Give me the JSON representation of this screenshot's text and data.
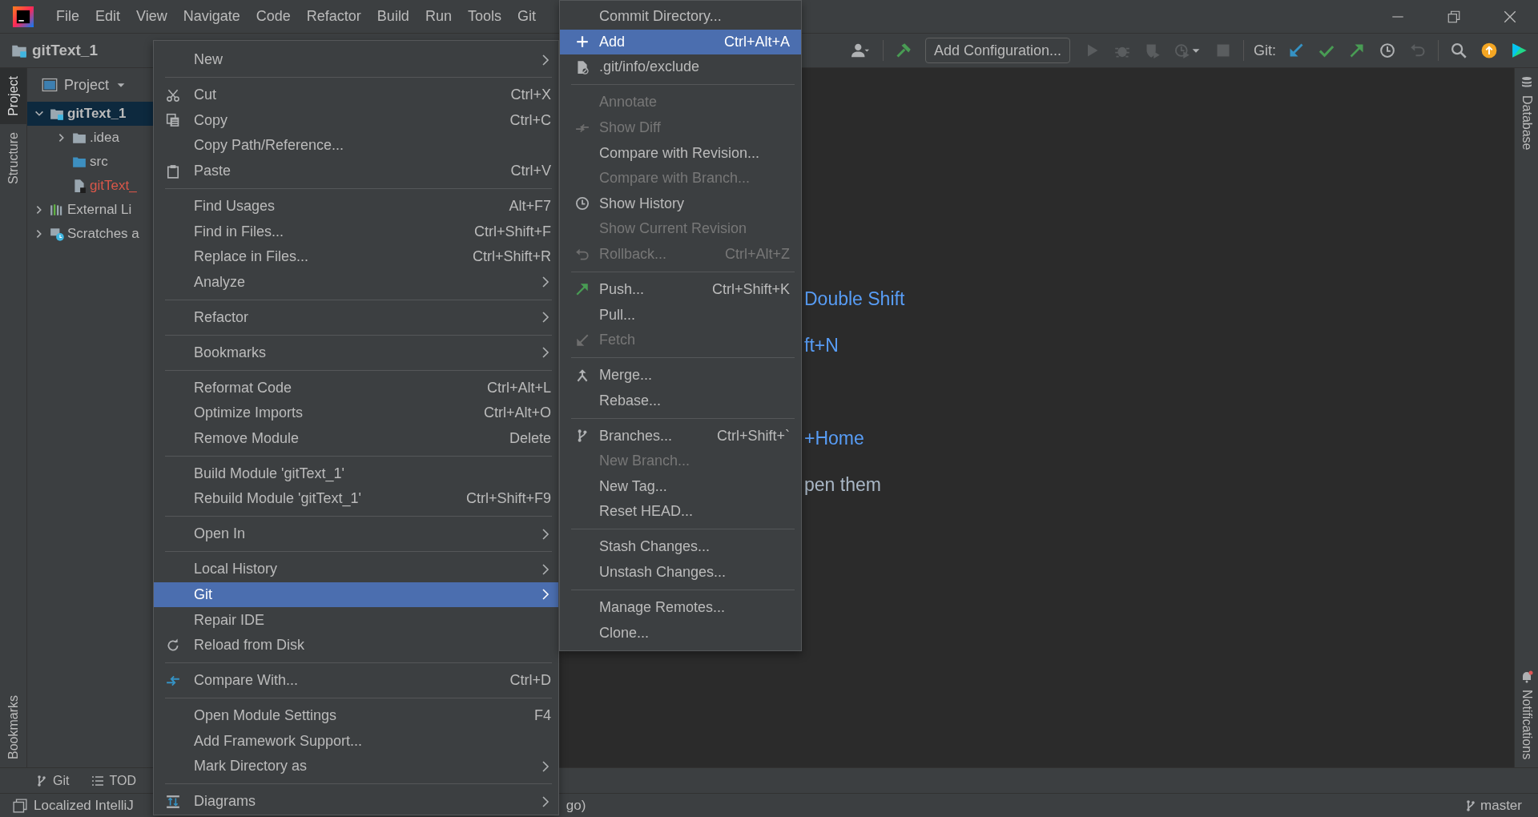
{
  "menu_bar": [
    "File",
    "Edit",
    "View",
    "Navigate",
    "Code",
    "Refactor",
    "Build",
    "Run",
    "Tools",
    "Git"
  ],
  "nav_bar": {
    "project": "gitText_1"
  },
  "toolbar": {
    "run_config": "Add Configuration...",
    "git_label": "Git:"
  },
  "left_tabs": {
    "top": [
      {
        "label": "Project",
        "selected": true
      },
      {
        "label": "Structure",
        "selected": false
      }
    ],
    "bottom": [
      {
        "label": "Bookmarks",
        "selected": false
      }
    ]
  },
  "project_panel": {
    "title": "Project",
    "tree": [
      {
        "label": "gitText_1",
        "kind": "module",
        "selected": true,
        "expanded": true,
        "color": "#bbbbbb",
        "children": [
          {
            "label": ".idea",
            "kind": "folder",
            "selected": false,
            "expanded": false,
            "color": "#bbbbbb"
          },
          {
            "label": "src",
            "kind": "source",
            "selected": false,
            "color": "#bbbbbb"
          },
          {
            "label": "gitText_",
            "kind": "file",
            "selected": false,
            "color": "#d9574a"
          }
        ]
      },
      {
        "label": "External Li",
        "kind": "library",
        "selected": false,
        "expanded": false,
        "color": "#bbbbbb"
      },
      {
        "label": "Scratches a",
        "kind": "scratch",
        "selected": false,
        "expanded": false,
        "color": "#bbbbbb"
      }
    ]
  },
  "editor_hints": [
    {
      "text": "Double Shift",
      "kind": "shortcut"
    },
    {
      "text": "ft+N",
      "kind": "shortcut"
    },
    {
      "text": "+Home",
      "kind": "shortcut"
    },
    {
      "text": "pen them",
      "kind": "text"
    }
  ],
  "right_tabs": {
    "top": [
      {
        "label": "Database",
        "selected": false
      }
    ],
    "bottom": [
      {
        "label": "Notifications",
        "selected": false
      }
    ]
  },
  "bottom_tabs": [
    "Git",
    "TOD"
  ],
  "status_bar": {
    "message": "Localized IntelliJ",
    "message_tail": "go)",
    "branch": "master"
  },
  "context_menu": {
    "items": [
      {
        "kind": "item",
        "label": "New",
        "selected": false,
        "submenu": true
      },
      {
        "kind": "separator"
      },
      {
        "kind": "item",
        "label": "Cut",
        "shortcut": "Ctrl+X",
        "selected": false,
        "submenu": false
      },
      {
        "kind": "item",
        "label": "Copy",
        "shortcut": "Ctrl+C",
        "selected": false,
        "submenu": false
      },
      {
        "kind": "item",
        "label": "Copy Path/Reference...",
        "selected": false,
        "submenu": false
      },
      {
        "kind": "item",
        "label": "Paste",
        "shortcut": "Ctrl+V",
        "selected": false,
        "submenu": false
      },
      {
        "kind": "separator"
      },
      {
        "kind": "item",
        "label": "Find Usages",
        "shortcut": "Alt+F7",
        "selected": false,
        "submenu": false
      },
      {
        "kind": "item",
        "label": "Find in Files...",
        "shortcut": "Ctrl+Shift+F",
        "selected": false,
        "submenu": false
      },
      {
        "kind": "item",
        "label": "Replace in Files...",
        "shortcut": "Ctrl+Shift+R",
        "selected": false,
        "submenu": false
      },
      {
        "kind": "item",
        "label": "Analyze",
        "selected": false,
        "submenu": true
      },
      {
        "kind": "separator"
      },
      {
        "kind": "item",
        "label": "Refactor",
        "selected": false,
        "submenu": true
      },
      {
        "kind": "separator"
      },
      {
        "kind": "item",
        "label": "Bookmarks",
        "selected": false,
        "submenu": true
      },
      {
        "kind": "separator"
      },
      {
        "kind": "item",
        "label": "Reformat Code",
        "shortcut": "Ctrl+Alt+L",
        "selected": false,
        "submenu": false
      },
      {
        "kind": "item",
        "label": "Optimize Imports",
        "shortcut": "Ctrl+Alt+O",
        "selected": false,
        "submenu": false
      },
      {
        "kind": "item",
        "label": "Remove Module",
        "shortcut": "Delete",
        "selected": false,
        "submenu": false
      },
      {
        "kind": "separator"
      },
      {
        "kind": "item",
        "label": "Build Module 'gitText_1'",
        "selected": false,
        "submenu": false
      },
      {
        "kind": "item",
        "label": "Rebuild Module 'gitText_1'",
        "shortcut": "Ctrl+Shift+F9",
        "selected": false,
        "submenu": false
      },
      {
        "kind": "separator"
      },
      {
        "kind": "item",
        "label": "Open In",
        "selected": false,
        "submenu": true
      },
      {
        "kind": "separator"
      },
      {
        "kind": "item",
        "label": "Local History",
        "selected": false,
        "submenu": true
      },
      {
        "kind": "item",
        "label": "Git",
        "selected": true,
        "submenu": true
      },
      {
        "kind": "item",
        "label": "Repair IDE",
        "selected": false,
        "submenu": false
      },
      {
        "kind": "item",
        "label": "Reload from Disk",
        "selected": false,
        "submenu": false
      },
      {
        "kind": "separator"
      },
      {
        "kind": "item",
        "label": "Compare With...",
        "shortcut": "Ctrl+D",
        "selected": false,
        "submenu": false
      },
      {
        "kind": "separator"
      },
      {
        "kind": "item",
        "label": "Open Module Settings",
        "shortcut": "F4",
        "selected": false,
        "submenu": false
      },
      {
        "kind": "item",
        "label": "Add Framework Support...",
        "selected": false,
        "submenu": false
      },
      {
        "kind": "item",
        "label": "Mark Directory as",
        "selected": false,
        "submenu": true
      },
      {
        "kind": "separator"
      },
      {
        "kind": "item",
        "label": "Diagrams",
        "selected": false,
        "submenu": true
      }
    ]
  },
  "git_submenu": {
    "items": [
      {
        "kind": "item",
        "label": "Commit Directory...",
        "selected": false,
        "disabled": false
      },
      {
        "kind": "item",
        "label": "Add",
        "shortcut": "Ctrl+Alt+A",
        "selected": true,
        "disabled": false
      },
      {
        "kind": "item",
        "label": ".git/info/exclude",
        "selected": false,
        "disabled": false
      },
      {
        "kind": "separator"
      },
      {
        "kind": "item",
        "label": "Annotate",
        "selected": false,
        "disabled": true
      },
      {
        "kind": "item",
        "label": "Show Diff",
        "selected": false,
        "disabled": true
      },
      {
        "kind": "item",
        "label": "Compare with Revision...",
        "selected": false,
        "disabled": false
      },
      {
        "kind": "item",
        "label": "Compare with Branch...",
        "selected": false,
        "disabled": true
      },
      {
        "kind": "item",
        "label": "Show History",
        "selected": false,
        "disabled": false
      },
      {
        "kind": "item",
        "label": "Show Current Revision",
        "selected": false,
        "disabled": true
      },
      {
        "kind": "item",
        "label": "Rollback...",
        "shortcut": "Ctrl+Alt+Z",
        "selected": false,
        "disabled": true
      },
      {
        "kind": "separator"
      },
      {
        "kind": "item",
        "label": "Push...",
        "shortcut": "Ctrl+Shift+K",
        "selected": false,
        "disabled": false
      },
      {
        "kind": "item",
        "label": "Pull...",
        "selected": false,
        "disabled": false
      },
      {
        "kind": "item",
        "label": "Fetch",
        "selected": false,
        "disabled": true
      },
      {
        "kind": "separator"
      },
      {
        "kind": "item",
        "label": "Merge...",
        "selected": false,
        "disabled": false
      },
      {
        "kind": "item",
        "label": "Rebase...",
        "selected": false,
        "disabled": false
      },
      {
        "kind": "separator"
      },
      {
        "kind": "item",
        "label": "Branches...",
        "shortcut": "Ctrl+Shift+`",
        "selected": false,
        "disabled": false
      },
      {
        "kind": "item",
        "label": "New Branch...",
        "selected": false,
        "disabled": true
      },
      {
        "kind": "item",
        "label": "New Tag...",
        "selected": false,
        "disabled": false
      },
      {
        "kind": "item",
        "label": "Reset HEAD...",
        "selected": false,
        "disabled": false
      },
      {
        "kind": "separator"
      },
      {
        "kind": "item",
        "label": "Stash Changes...",
        "selected": false,
        "disabled": false
      },
      {
        "kind": "item",
        "label": "Unstash Changes...",
        "selected": false,
        "disabled": false
      },
      {
        "kind": "separator"
      },
      {
        "kind": "item",
        "label": "Manage Remotes...",
        "selected": false,
        "disabled": false
      },
      {
        "kind": "item",
        "label": "Clone...",
        "selected": false,
        "disabled": false
      }
    ]
  }
}
